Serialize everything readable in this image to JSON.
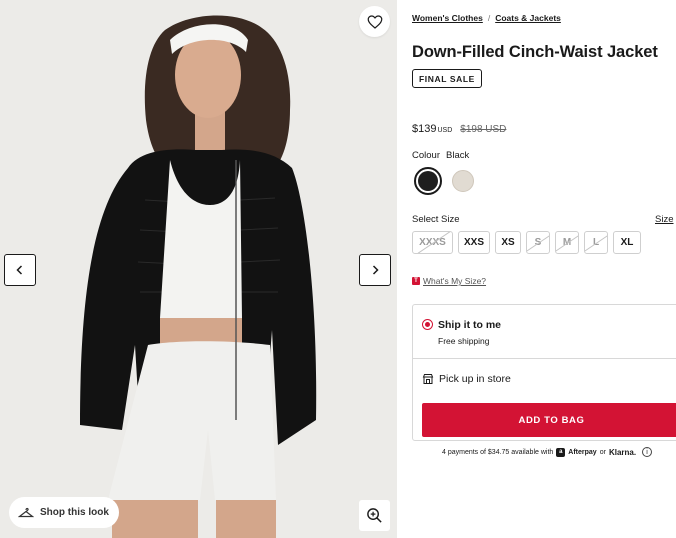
{
  "gallery": {
    "shop_look_label": "Shop this look",
    "icons": {
      "wishlist": "heart-icon",
      "prev": "chevron-left-icon",
      "next": "chevron-right-icon",
      "shop_look": "hanger-icon",
      "zoom": "zoom-in-icon"
    }
  },
  "breadcrumb": {
    "items": [
      "Women's Clothes",
      "Coats & Jackets"
    ],
    "separator": "/"
  },
  "product": {
    "title": "Down-Filled Cinch-Waist Jacket",
    "badge": "FINAL SALE",
    "price": {
      "current": "$139",
      "currency": "USD",
      "original": "$198 USD"
    }
  },
  "colour": {
    "label": "Colour",
    "selected": "Black",
    "swatches": [
      {
        "name": "Black",
        "color": "#1e1e1e",
        "selected": true
      },
      {
        "name": "Bone",
        "color": "#e1dbd2",
        "selected": false
      }
    ]
  },
  "size": {
    "label": "Select Size",
    "guide_label": "Size",
    "options": [
      {
        "label": "XXXS",
        "available": false
      },
      {
        "label": "XXS",
        "available": true
      },
      {
        "label": "XS",
        "available": true
      },
      {
        "label": "S",
        "available": false
      },
      {
        "label": "M",
        "available": false
      },
      {
        "label": "L",
        "available": false
      },
      {
        "label": "XL",
        "available": true
      }
    ]
  },
  "whats_my_size": {
    "badge": "T",
    "label": "What's My Size?"
  },
  "fulfilment": {
    "ship_title": "Ship it to me",
    "ship_subtitle": "Free shipping",
    "pickup_label": "Pick up in store",
    "add_to_bag": "ADD TO BAG"
  },
  "payments": {
    "prefix": "4 payments of $34.75 available with",
    "afterpay_mark": "a",
    "afterpay": "Afterpay",
    "or": "or",
    "klarna": "Klarna.",
    "info": "i"
  },
  "colors": {
    "accent": "#d31334",
    "text": "#1a1a1a",
    "gallery_bg": "#ecebe8"
  }
}
